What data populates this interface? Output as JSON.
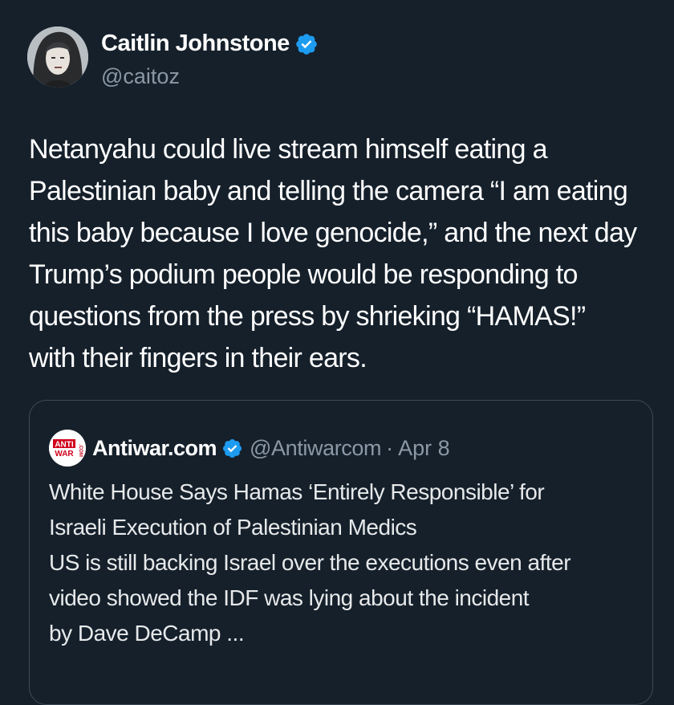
{
  "tweet": {
    "author": {
      "name": "Caitlin Johnstone",
      "handle": "@caitoz",
      "verified": true
    },
    "body_lines": [
      "Netanyahu could live stream himself eating a",
      "Palestinian baby and telling the camera “I am eating",
      "this baby because I love genocide,” and the next day",
      "Trump’s podium people would be responding to",
      "questions from the press by shrieking “HAMAS!”",
      "with their fingers in their ears."
    ]
  },
  "quoted": {
    "avatar_text_top": "ANTI",
    "avatar_text_bottom": "WAR",
    "avatar_text_side": ".COM",
    "name": "Antiwar.com",
    "handle": "@Antiwarcom",
    "separator": "·",
    "date": "Apr 8",
    "body_lines": [
      "White House Says Hamas ‘Entirely Responsible’ for",
      "Israeli Execution of Palestinian Medics",
      "US is still backing Israel over the executions even after",
      "video showed the IDF was lying about the incident",
      "by Dave DeCamp ..."
    ]
  },
  "colors": {
    "background": "#15202b",
    "verified_badge": "#1d9bf0",
    "secondary_text": "#8b98a5",
    "antiwar_red": "#d0021b"
  },
  "icons": [
    "verified-badge-icon"
  ]
}
